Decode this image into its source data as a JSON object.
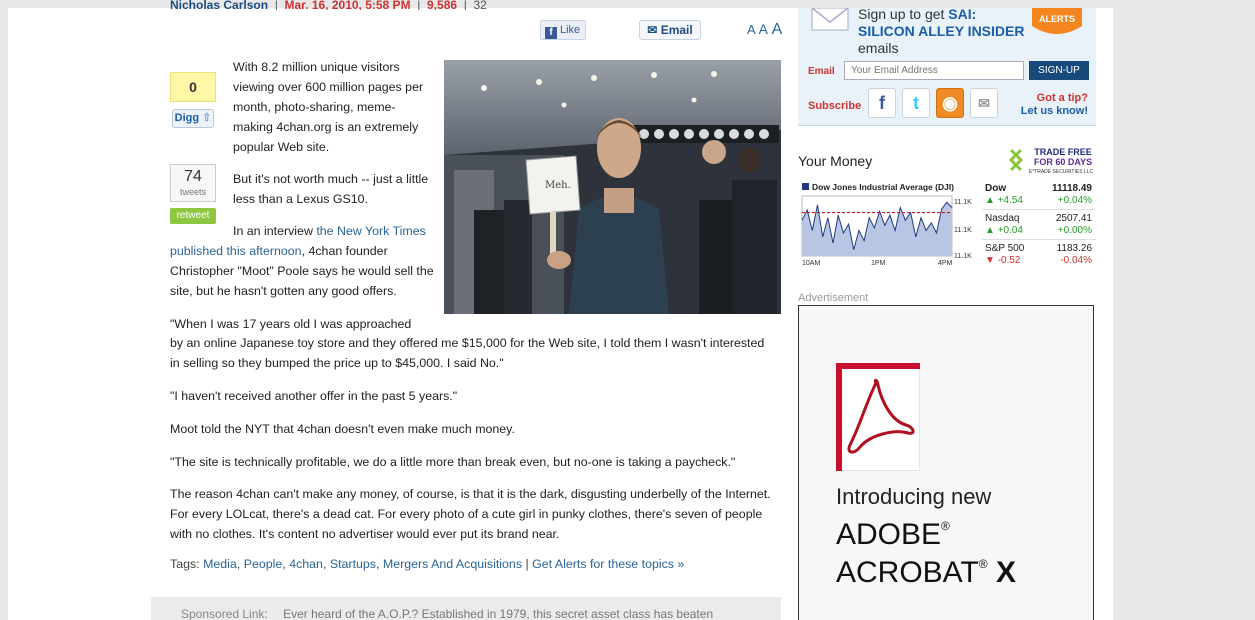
{
  "byline": {
    "author": "Nicholas Carlson",
    "date": "Mar. 16, 2010, 5:58 PM",
    "views": "9,586",
    "comments": "32"
  },
  "share": {
    "like_label": "Like",
    "email_label": "Email",
    "text_sizes": [
      "A",
      "A",
      "A"
    ]
  },
  "digg": {
    "count": "0",
    "button_label": "Digg"
  },
  "tweets": {
    "count": "74",
    "label": "tweets",
    "retweet_label": "retweet"
  },
  "photo": {
    "sign_text": "Meh."
  },
  "article": {
    "p1": "With 8.2 million unique visitors viewing over 600 million pages per month, photo-sharing, meme-making 4chan.org is an extremely popular Web site.",
    "p2": "But it's not worth much -- just a little less than a Lexus GS10.",
    "p3_before": "In an interview ",
    "p3_link": "the New York Times published this afternoon",
    "p3_after": ", 4chan founder Christopher \"Moot\" Poole says he would sell the site, but he hasn't gotten any good offers.",
    "p4_line1": "\"When I was 17 years old I was approached",
    "p4_rest": "by an online Japanese toy store and they offered me $15,000 for the Web site, I told them I wasn't interested in selling so they bumped the price up to $45,000. I said No.\"",
    "p5": "\"I haven't received another offer in the past 5 years.\"",
    "p6": "Moot told the NYT that 4chan doesn't even make much money.",
    "p7": "\"The site is technically profitable, we do a little more than break even, but no-one is taking a paycheck.\"",
    "p8": "The reason 4chan can't make any money, of course, is that it is the dark, disgusting underbelly of the Internet. For every LOLcat, there's a dead cat. For every photo of a cute girl in punky clothes, there's seven of people with no clothes. It's content no advertiser would ever put its brand near."
  },
  "tags": {
    "label": "Tags: ",
    "items": [
      "Media",
      "People",
      "4chan",
      "Startups",
      "Mergers And Acquisitions"
    ],
    "sep": ", ",
    "alerts_link": "Get Alerts for these topics »"
  },
  "sponsored": {
    "label": "Sponsored Link:",
    "text": "Ever heard of the A.O.P.? Established in 1979, this secret asset class has beaten"
  },
  "signup": {
    "line1": "Sign up to get ",
    "line1_b": "SAI:",
    "line2": "SILICON ALLEY INSIDER",
    "line3": "emails",
    "badge": "ALERTS",
    "email_label": "Email",
    "email_placeholder": "Your Email Address",
    "button_label": "SIGN-UP",
    "subscribe_label": "Subscribe",
    "tip_line1": "Got a tip?",
    "tip_line2": "Let us know!"
  },
  "your_money": {
    "title": "Your Money",
    "promo_line1": "TRADE FREE",
    "promo_line2": "FOR 60 DAYS",
    "promo_line3": "E*TRADE SECURITIES LLC"
  },
  "chart_data": {
    "type": "line",
    "title": "Dow Jones Industrial Average (DJI)",
    "x_ticks": [
      "10AM",
      "1PM",
      "4PM"
    ],
    "y_ticks": [
      "11.1K",
      "11.1K",
      "11.1K"
    ],
    "reference_line": "previous close",
    "series": [
      {
        "values": [
          11108,
          11116,
          11100,
          11120,
          11095,
          11110,
          11090,
          11112,
          11098,
          11105,
          11085,
          11100,
          11092,
          11110,
          11102,
          11115,
          11104,
          11112,
          11100,
          11118,
          11108,
          11114,
          11095,
          11110,
          11100,
          11106,
          11098,
          11117,
          11122,
          11118
        ]
      }
    ],
    "colors": {
      "line": "#1f3a80",
      "fill": "#b9c6e3",
      "ref": "#cc0000"
    }
  },
  "quotes": [
    {
      "name": "Dow",
      "value": "11118.49",
      "change": "+4.54",
      "pct": "+0.04%",
      "dir": "up"
    },
    {
      "name": "Nasdaq",
      "value": "2507.41",
      "change": "+0.04",
      "pct": "+0.00%",
      "dir": "up"
    },
    {
      "name": "S&P 500",
      "value": "1183.26",
      "change": "-0.52",
      "pct": "-0.04%",
      "dir": "down"
    }
  ],
  "ad": {
    "label": "Advertisement",
    "line1": "Introducing new",
    "line2": "ADOBE",
    "line3": "ACROBAT",
    "line3_b": "X"
  }
}
